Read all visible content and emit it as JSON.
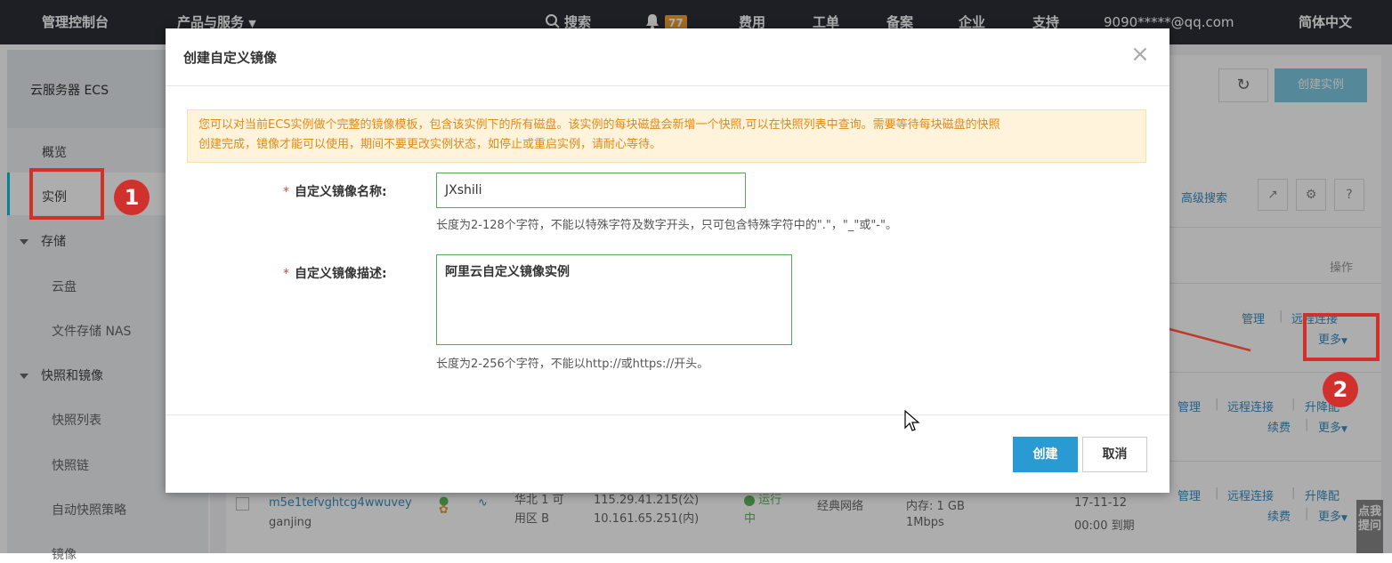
{
  "topbar": {
    "console": "管理控制台",
    "products": "产品与服务",
    "search": "搜索",
    "badge": "77",
    "nav": [
      "费用",
      "工单",
      "备案",
      "企业",
      "支持"
    ],
    "account": "9090*****@qq.com",
    "language": "简体中文"
  },
  "sidebar": {
    "title": "云服务器 ECS",
    "items": {
      "overview": "概览",
      "instances": "实例",
      "storage": "存储",
      "cloud_disk": "云盘",
      "nas": "文件存储 NAS",
      "snapshot_image": "快照和镜像",
      "snapshot_list": "快照列表",
      "snapshot_chain": "快照链",
      "auto_snapshot": "自动快照策略",
      "image": "镜像"
    }
  },
  "annotations": {
    "step1": "1",
    "step2": "2"
  },
  "background": {
    "create_instance": "创建实例",
    "advanced_search": "高级搜索",
    "help_q": "?",
    "column_operation": "操作",
    "manage": "管理",
    "remote": "远程连接",
    "upgrade": "升降配",
    "renew": "续费",
    "more": "更多",
    "row3": {
      "id": "m5e1tefvghtcg4wwuvey",
      "name": "ganjing",
      "zone1": "华北 1 可",
      "zone2": "用区 B",
      "ip_public": "115.29.41.215(公)",
      "ip_private": "10.161.65.251(内)",
      "status1": "运行",
      "status2": "中",
      "network": "经典网络",
      "memory": "内存: 1 GB",
      "bandwidth": "1Mbps",
      "date": "17-11-12",
      "expire": "00:00 到期"
    },
    "hint_tab": "点我提问"
  },
  "dialog": {
    "title": "创建自定义镜像",
    "close": "×",
    "notice_line1": "您可以对当前ECS实例做个完整的镜像模板，包含该实例下的所有磁盘。该实例的每块磁盘会新增一个快照,可以在快照列表中查询。需要等待每块磁盘的快照",
    "notice_line2": "创建完成，镜像才能可以使用，期间不要更改实例状态，如停止或重启实例，请耐心等待。",
    "star": "*",
    "name_label": "自定义镜像名称:",
    "name_value": "JXshili",
    "name_help": "长度为2-128个字符，不能以特殊字符及数字开头，只可包含特殊字符中的\".\"，\"_\"或\"-\"。",
    "desc_label": "自定义镜像描述:",
    "desc_value": "阿里云自定义镜像实例",
    "desc_help": "长度为2-256个字符，不能以http://或https://开头。",
    "create_button": "创建",
    "cancel_button": "取消"
  }
}
